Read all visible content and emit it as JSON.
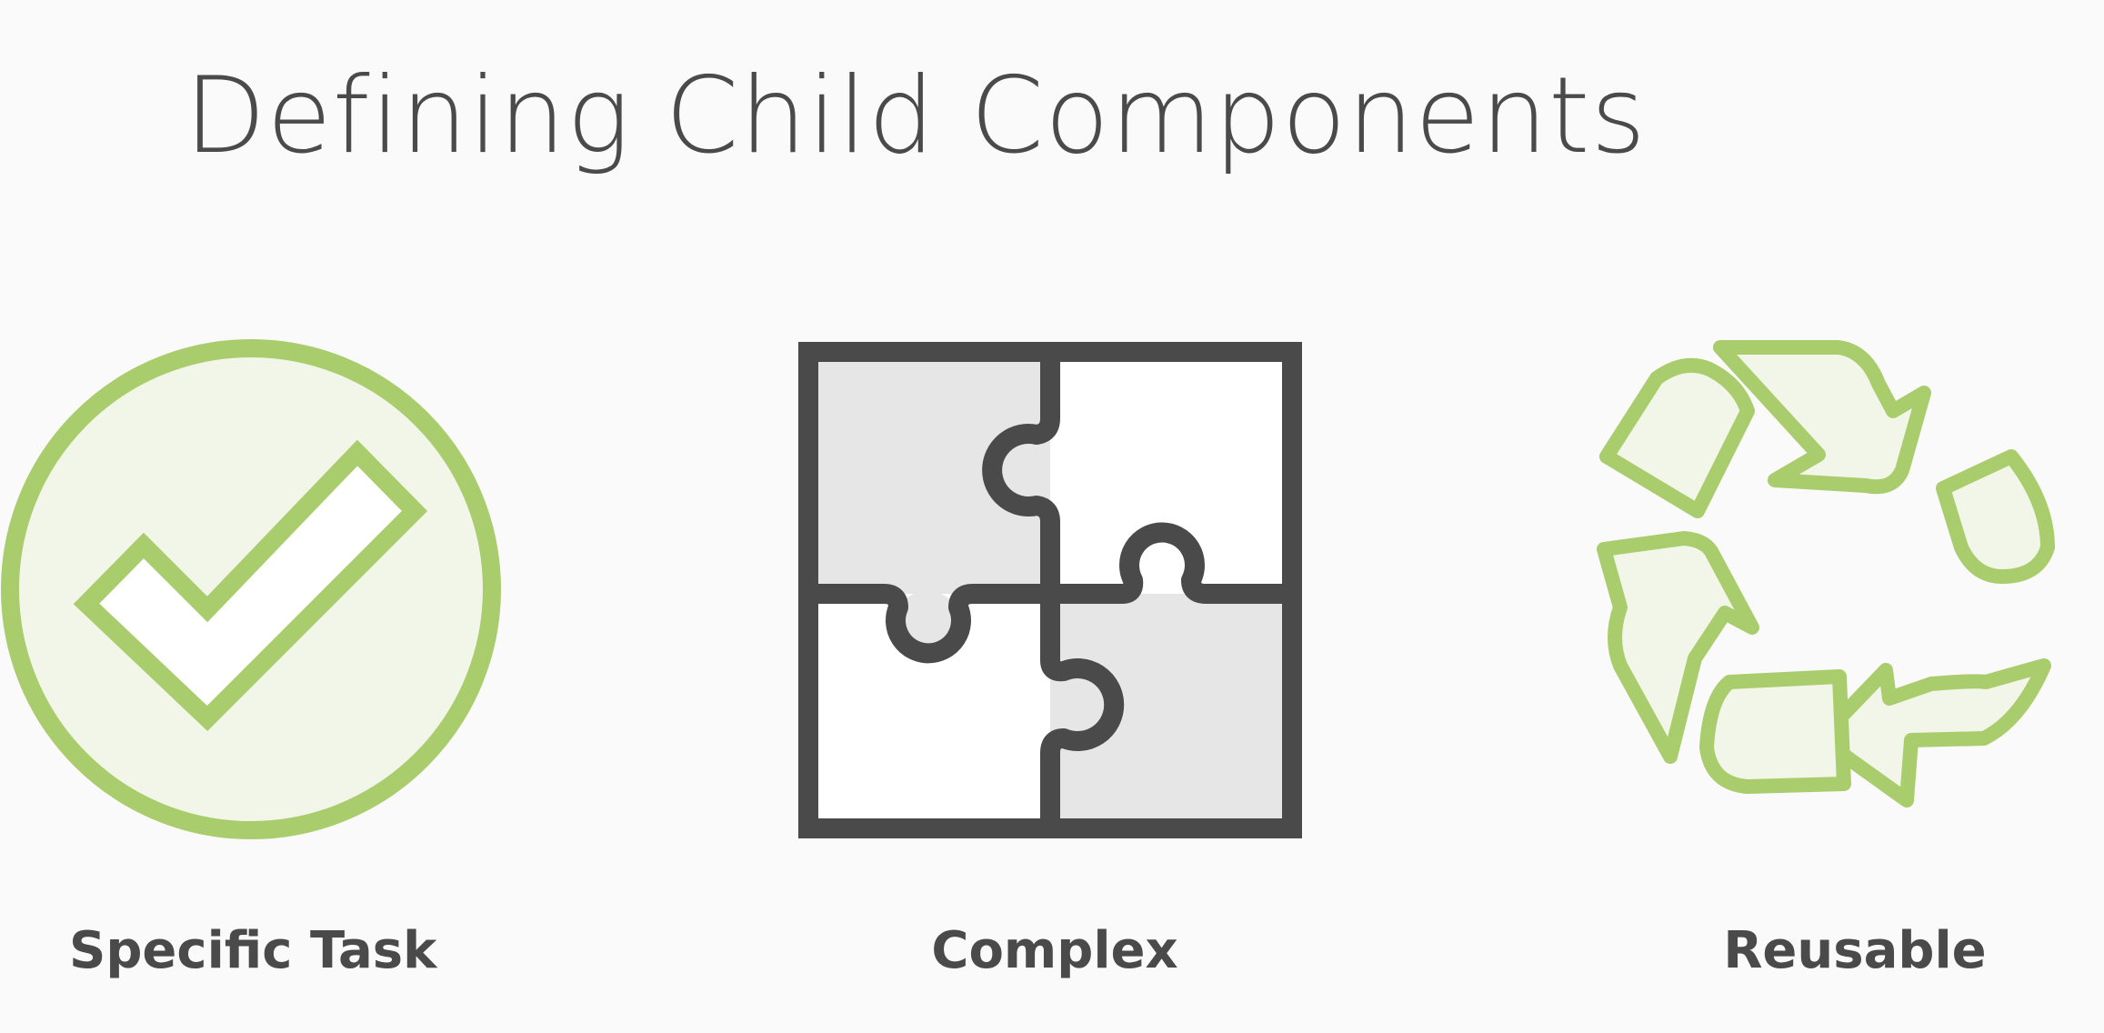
{
  "slide": {
    "title": "Defining Child Components",
    "items": [
      {
        "label": "Specific Task",
        "icon": "check-circle-icon"
      },
      {
        "label": "Complex",
        "icon": "puzzle-icon"
      },
      {
        "label": "Reusable",
        "icon": "recycle-icon"
      }
    ]
  },
  "colors": {
    "accent_green": "#a9cd6c",
    "accent_green_fill": "#f2f6e9",
    "dark_gray": "#4a4a4a",
    "light_gray": "#e6e6e6",
    "background": "#fafafa"
  }
}
